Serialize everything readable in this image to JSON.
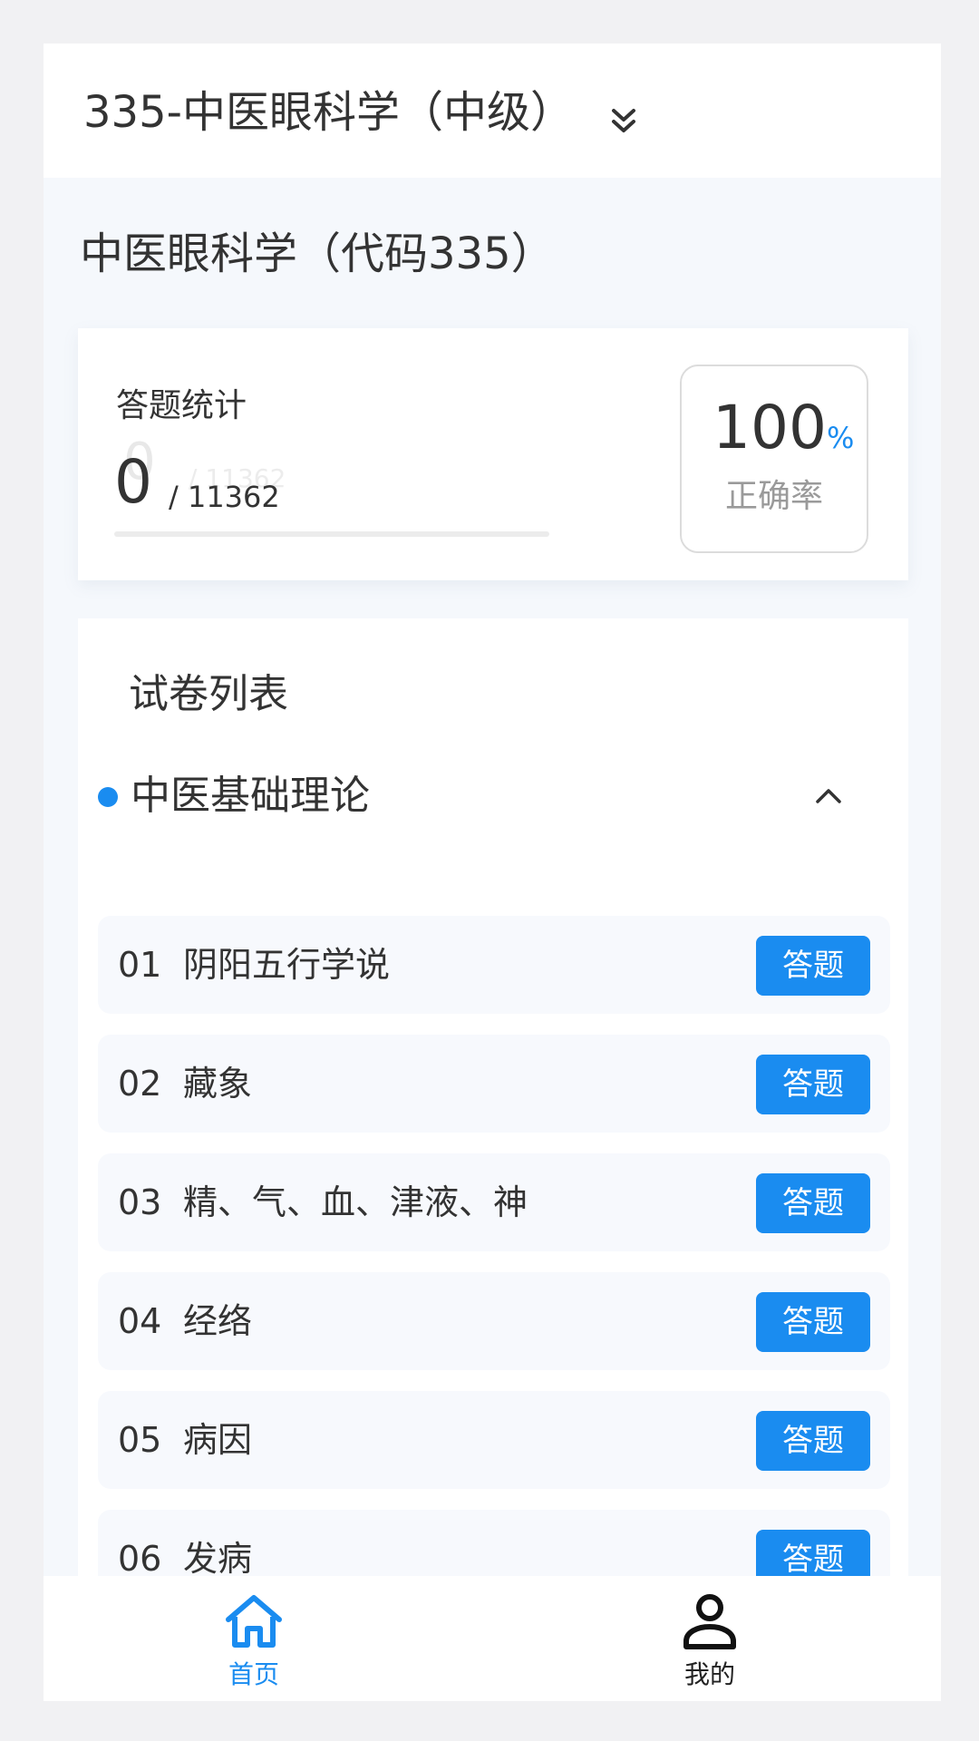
{
  "header": {
    "exam_selector": "335-中医眼科学（中级）",
    "selector_icon": "double-chevron-down-icon"
  },
  "subject_title": "中医眼科学（代码335）",
  "stats": {
    "label": "答题统计",
    "answered": "0",
    "total": "/ 11362",
    "ghost_answered": "0",
    "ghost_total": "/ 11362",
    "progress_fraction": 0,
    "accuracy_value": "100",
    "accuracy_unit": "%",
    "accuracy_label": "正确率"
  },
  "paper_list": {
    "title": "试卷列表",
    "section": {
      "name": "中医基础理论",
      "collapse_icon": "chevron-up-icon",
      "items": [
        {
          "num": "01",
          "name": "阴阳五行学说",
          "button": "答题"
        },
        {
          "num": "02",
          "name": "藏象",
          "button": "答题"
        },
        {
          "num": "03",
          "name": "精、气、血、津液、神",
          "button": "答题"
        },
        {
          "num": "04",
          "name": "经络",
          "button": "答题"
        },
        {
          "num": "05",
          "name": "病因",
          "button": "答题"
        },
        {
          "num": "06",
          "name": "发病",
          "button": "答题"
        }
      ]
    }
  },
  "tabbar": {
    "tabs": [
      {
        "label": "首页",
        "icon": "home-icon",
        "active": true
      },
      {
        "label": "我的",
        "icon": "user-icon",
        "active": false
      }
    ]
  },
  "colors": {
    "accent": "#1a8cf0",
    "background": "#f5f8fc"
  }
}
